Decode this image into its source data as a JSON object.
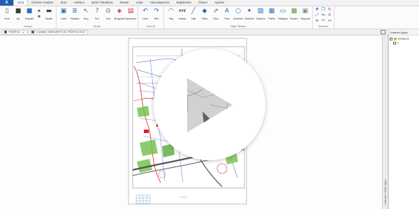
{
  "app_button": {
    "label": "A",
    "color": "#1e5fb4"
  },
  "tabs": [
    {
      "label": "Giriş",
      "active": true
    },
    {
      "label": "Üretme Araçları"
    },
    {
      "label": "İmar"
    },
    {
      "label": "Hobbus"
    },
    {
      "label": "Şehir Planlama"
    },
    {
      "label": "Raster"
    },
    {
      "label": "Lidar"
    },
    {
      "label": "Kamulaştırma"
    },
    {
      "label": "Bağlantılar"
    },
    {
      "label": "Ölçüm"
    },
    {
      "label": "Ayarlar"
    }
  ],
  "ribbon": {
    "groups": [
      {
        "label": "Dosya",
        "items": [
          {
            "label": "Yeni",
            "icon": "new-file-icon"
          },
          {
            "label": "Aç",
            "icon": "open-folder-icon"
          },
          {
            "label": "Kaydet",
            "icon": "save-icon"
          },
          {
            "stack": [
              "save-as-icon",
              "export-icon"
            ]
          },
          {
            "label": "Yazdır",
            "icon": "print-icon"
          }
        ]
      },
      {
        "label": "Ekran",
        "items": [
          {
            "label": "Limit",
            "icon": "zoom-limit-icon"
          },
          {
            "label": "Tabaka",
            "icon": "layers-icon"
          },
          {
            "label": "Seç",
            "icon": "select-icon"
          },
          {
            "label": "Sor",
            "icon": "query-icon"
          },
          {
            "label": "Ara",
            "icon": "search-icon"
          },
          {
            "label": "Bulgular",
            "icon": "findings-icon"
          },
          {
            "label": "Nesneler",
            "icon": "objects-icon"
          }
        ]
      },
      {
        "label": "Geri Al",
        "items": [
          {
            "label": "Geri",
            "icon": "undo-icon"
          },
          {
            "label": "İleri",
            "icon": "redo-icon"
          }
        ]
      },
      {
        "label": "Obje Oluştur",
        "items": [
          {
            "label": "Yay",
            "icon": "arc-icon"
          },
          {
            "label": "Nokta",
            "icon": "xyz-point-icon"
          },
          {
            "label": "Hat",
            "icon": "line-icon"
          },
          {
            "label": "Ölçü",
            "icon": "measure-icon"
          },
          {
            "label": "Oku",
            "icon": "arrow-icon"
          },
          {
            "label": "Yazı",
            "icon": "text-icon"
          },
          {
            "label": "Çember",
            "icon": "circle-icon"
          },
          {
            "label": "Sembol",
            "icon": "symbol-icon"
          },
          {
            "label": "Tarama",
            "icon": "hatch-icon"
          },
          {
            "label": "Pafta",
            "icon": "sheet-icon"
          },
          {
            "label": "Dörtgen",
            "icon": "rectangle-icon"
          },
          {
            "label": "Resim",
            "icon": "image-icon"
          },
          {
            "label": "Sayısal",
            "icon": "numeric-icon"
          }
        ]
      },
      {
        "label": "Düzenle",
        "grid": [
          "move-icon",
          "copy-icon",
          "rotate-icon",
          "scale-icon",
          "mirror-icon",
          "erase-icon",
          "offset-icon",
          "trim-icon",
          "extend-icon"
        ]
      }
    ]
  },
  "document_bar": {
    "tabs": [
      {
        "label": "YEDEK11"
      },
      {
        "label": "C:\\yedek\\_NetKurt\\EYLÜL\\YEDEK11.NCZ"
      }
    ]
  },
  "panel": {
    "title": "Katman Ağacı",
    "tree": [
      {
        "label": "YEDEK11",
        "level": 0
      },
      {
        "label": "0",
        "level": 1
      }
    ]
  },
  "side_tab": {
    "label": "Katman / Obje Ağacı"
  },
  "colors": {
    "accent": "#1e5fb4",
    "icon_blue": "#2a6fb5",
    "danger": "#cc3333"
  }
}
